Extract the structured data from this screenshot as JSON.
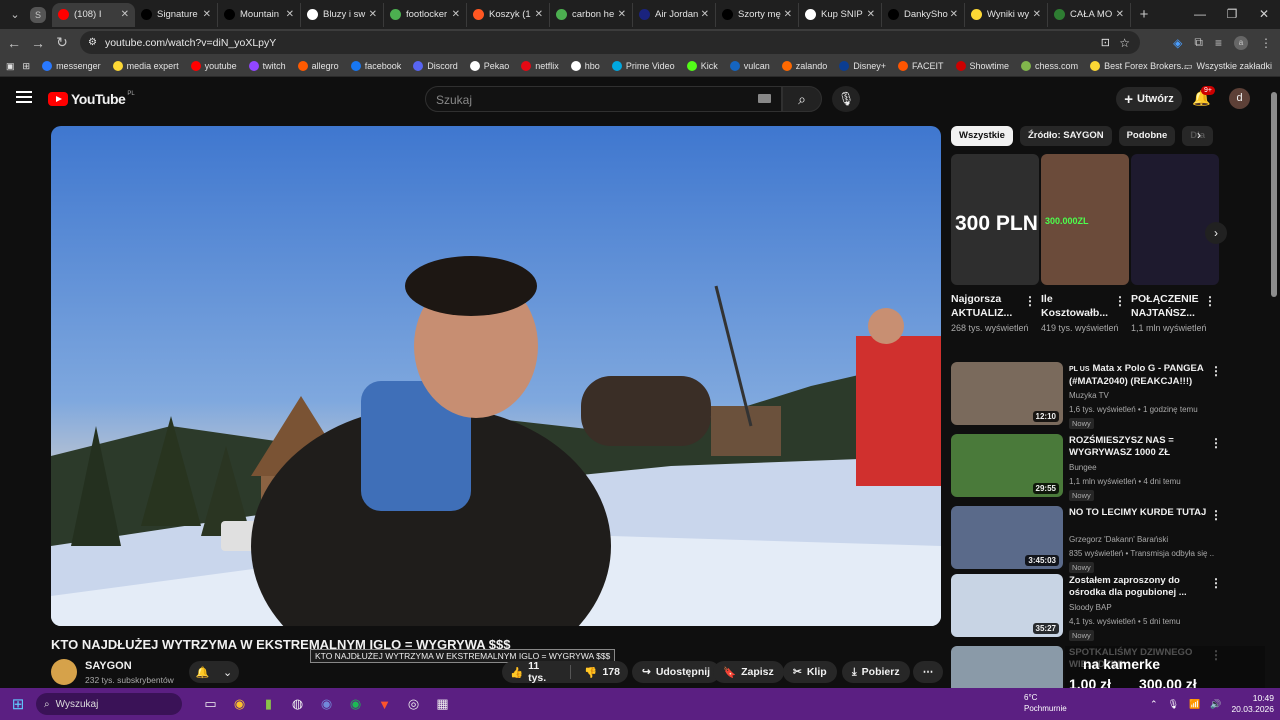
{
  "browser": {
    "tabs": [
      {
        "label": "(108) I",
        "color": "#ff0000",
        "active": true
      },
      {
        "label": "Signature",
        "color": "#000000"
      },
      {
        "label": "Mountain",
        "color": "#000000"
      },
      {
        "label": "Bluzy i sw",
        "color": "#ffffff"
      },
      {
        "label": "footlocker",
        "color": "#4caf50"
      },
      {
        "label": "Koszyk (1",
        "color": "#ff5722"
      },
      {
        "label": "carbon he",
        "color": "#4caf50"
      },
      {
        "label": "Air Jordan",
        "color": "#1a237e"
      },
      {
        "label": "Szorty mę",
        "color": "#000000"
      },
      {
        "label": "Kup SNIP",
        "color": "#ffffff"
      },
      {
        "label": "DankySho",
        "color": "#000000"
      },
      {
        "label": "Wyniki wy",
        "color": "#fdd835"
      },
      {
        "label": "CAŁA MO",
        "color": "#2e7d32"
      }
    ],
    "url": "youtube.com/watch?v=diN_yoXLpyY",
    "bookmarks": [
      {
        "label": "messenger",
        "color": "#2979ff"
      },
      {
        "label": "media expert",
        "color": "#fdd835"
      },
      {
        "label": "youtube",
        "color": "#ff0000"
      },
      {
        "label": "twitch",
        "color": "#9146ff"
      },
      {
        "label": "allegro",
        "color": "#ff5a00"
      },
      {
        "label": "facebook",
        "color": "#1877f2"
      },
      {
        "label": "Discord",
        "color": "#5865f2"
      },
      {
        "label": "Pekao",
        "color": "#ffffff"
      },
      {
        "label": "netflix",
        "color": "#e50914"
      },
      {
        "label": "hbo",
        "color": "#ffffff"
      },
      {
        "label": "Prime Video",
        "color": "#00a8e1"
      },
      {
        "label": "Kick",
        "color": "#53fc18"
      },
      {
        "label": "vulcan",
        "color": "#1565c0"
      },
      {
        "label": "zalando",
        "color": "#ff6900"
      },
      {
        "label": "Disney+",
        "color": "#0b3d91"
      },
      {
        "label": "FACEIT",
        "color": "#ff5500"
      },
      {
        "label": "Showtime",
        "color": "#cc0000"
      },
      {
        "label": "chess.com",
        "color": "#81b64c"
      },
      {
        "label": "Best Forex Brokers...",
        "color": "#fdd835"
      }
    ],
    "all_bookmarks": "Wszystkie zakładki"
  },
  "youtube": {
    "logo": "YouTube",
    "country": "PL",
    "search_placeholder": "Szukaj",
    "create_label": "Utwórz",
    "notif_badge": "9+",
    "avatar_letter": "d"
  },
  "video": {
    "title": "KTO NAJDŁUŻEJ WYTRZYMA W EKSTREMALNYM IGLO = WYGRYWA $$$",
    "tooltip": "KTO NAJDŁUŻEJ WYTRZYMA W EKSTREMALNYM IGLO = WYGRYWA $$$",
    "channel": "SAYGON",
    "subs": "232 tys. subskrybentów",
    "likes": "11 tys.",
    "dislikes": "178",
    "share": "Udostępnij",
    "save": "Zapisz",
    "clip": "Klip",
    "download": "Pobierz"
  },
  "chips": [
    "Wszystkie",
    "Źródło: SAYGON",
    "Podobne",
    "Dla"
  ],
  "shorts": [
    {
      "title": "Najgorsza AKTUALIZ...",
      "views": "268 tys. wyświetleń",
      "overlay": "300 PLN"
    },
    {
      "title": "Ile Kosztowałb...",
      "views": "419 tys. wyświetleń",
      "overlay": "300.000ZL"
    },
    {
      "title": "POŁĄCZENIE NAJTAŃSZ...",
      "views": "1,1 mln wyświetleń",
      "overlay": ""
    }
  ],
  "recs": [
    {
      "title": "Mata x Polo G - PANGEA (#MATA2040) (REAKCJA!!!)",
      "prefix": "PL US",
      "channel": "Muzyka TV",
      "meta": "1,6 tys. wyświetleń • 1 godzinę temu",
      "badge": "Nowy",
      "duration": "12:10"
    },
    {
      "title": "ROZŚMIESZYSZ NAS = WYGRYWASZ 1000 ZŁ",
      "prefix": "",
      "channel": "Bungee",
      "meta": "1,1 mln wyświetleń • 4 dni temu",
      "badge": "Nowy",
      "duration": "29:55"
    },
    {
      "title": "NO TO LECIMY KURDE TUTAJ",
      "prefix": "",
      "channel": "Grzegorz 'Dakann' Barański",
      "meta": "835 wyświetleń • Transmisja odbyła się ...",
      "badge": "Nowy",
      "duration": "3:45:03"
    },
    {
      "title": "Zostałem zaproszony do ośrodka dla pogubionej ...",
      "prefix": "",
      "channel": "Sloody BAP",
      "meta": "4,1 tys. wyświetleń • 5 dni temu",
      "badge": "Nowy",
      "duration": "35:27"
    },
    {
      "title": "SPOTKALIŚMY DZIWNEGO WIE...(DZIN)",
      "prefix": "",
      "channel": "",
      "meta": "",
      "badge": "",
      "duration": ""
    }
  ],
  "overlay": {
    "title": "na kamerke",
    "price1": "1,00 zł",
    "price2": "300,00 zł"
  },
  "taskbar": {
    "search": "Wyszukaj",
    "weather_temp": "6°C",
    "weather_desc": "Pochmurnie",
    "time": "10:49",
    "date": "20.03.2026"
  }
}
